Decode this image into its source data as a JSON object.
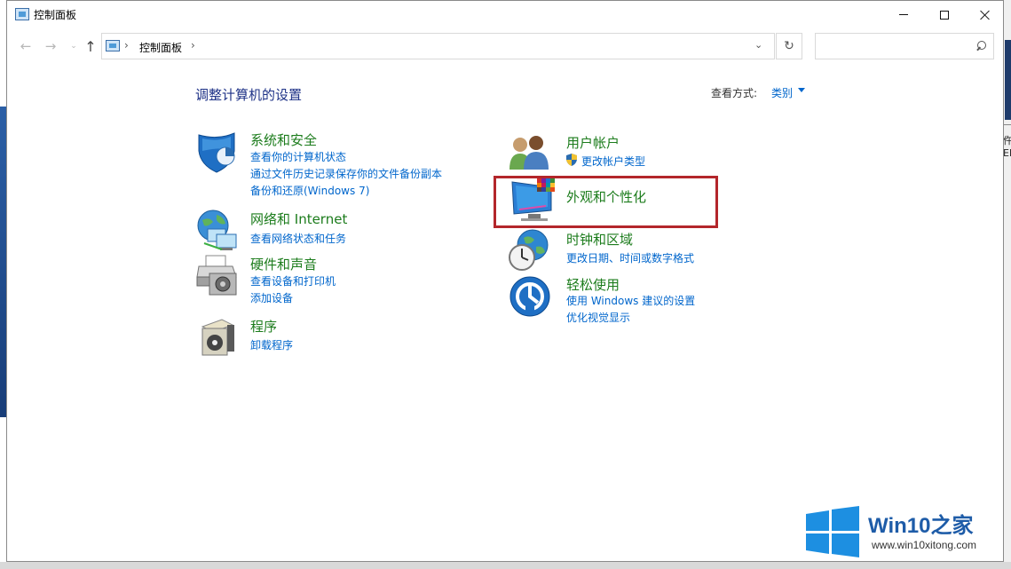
{
  "window": {
    "title": "控制面板"
  },
  "nav": {
    "back": "←",
    "forward": "→",
    "recent": "⌄",
    "up": "↑",
    "refresh": "↻",
    "address_sep": "›",
    "address_drop": "⌄"
  },
  "address": {
    "path": "控制面板"
  },
  "search": {
    "placeholder": ""
  },
  "page": {
    "heading": "调整计算机的设置",
    "view_by_label": "查看方式:",
    "view_by_value": "类别"
  },
  "categories": {
    "system": {
      "title": "系统和安全",
      "links": [
        "查看你的计算机状态",
        "通过文件历史记录保存你的文件备份副本",
        "备份和还原(Windows 7)"
      ],
      "icon": "shield-icon"
    },
    "network": {
      "title": "网络和 Internet",
      "links": [
        "查看网络状态和任务"
      ],
      "icon": "globe-network-icon"
    },
    "hardware": {
      "title": "硬件和声音",
      "links": [
        "查看设备和打印机",
        "添加设备"
      ],
      "icon": "printer-icon"
    },
    "programs": {
      "title": "程序",
      "links": [
        "卸载程序"
      ],
      "icon": "programs-box-icon"
    },
    "users": {
      "title": "用户帐户",
      "links": [
        "更改帐户类型"
      ],
      "icon": "users-icon"
    },
    "appearance": {
      "title": "外观和个性化",
      "links": [],
      "icon": "monitor-palette-icon"
    },
    "clock": {
      "title": "时钟和区域",
      "links": [
        "更改日期、时间或数字格式"
      ],
      "icon": "clock-globe-icon"
    },
    "ease": {
      "title": "轻松使用",
      "links": [
        "使用 Windows 建议的设置",
        "优化视觉显示"
      ],
      "icon": "ease-of-access-icon"
    }
  },
  "desktop": {
    "cut_text_1": "仵",
    "cut_text_2": "El"
  },
  "watermark": {
    "brand": "Win10之家",
    "url": "www.win10xitong.com"
  },
  "colors": {
    "link": "#0066cc",
    "category_title": "#1c7c1c",
    "heading": "#1e3287",
    "highlight": "#b3262b"
  }
}
